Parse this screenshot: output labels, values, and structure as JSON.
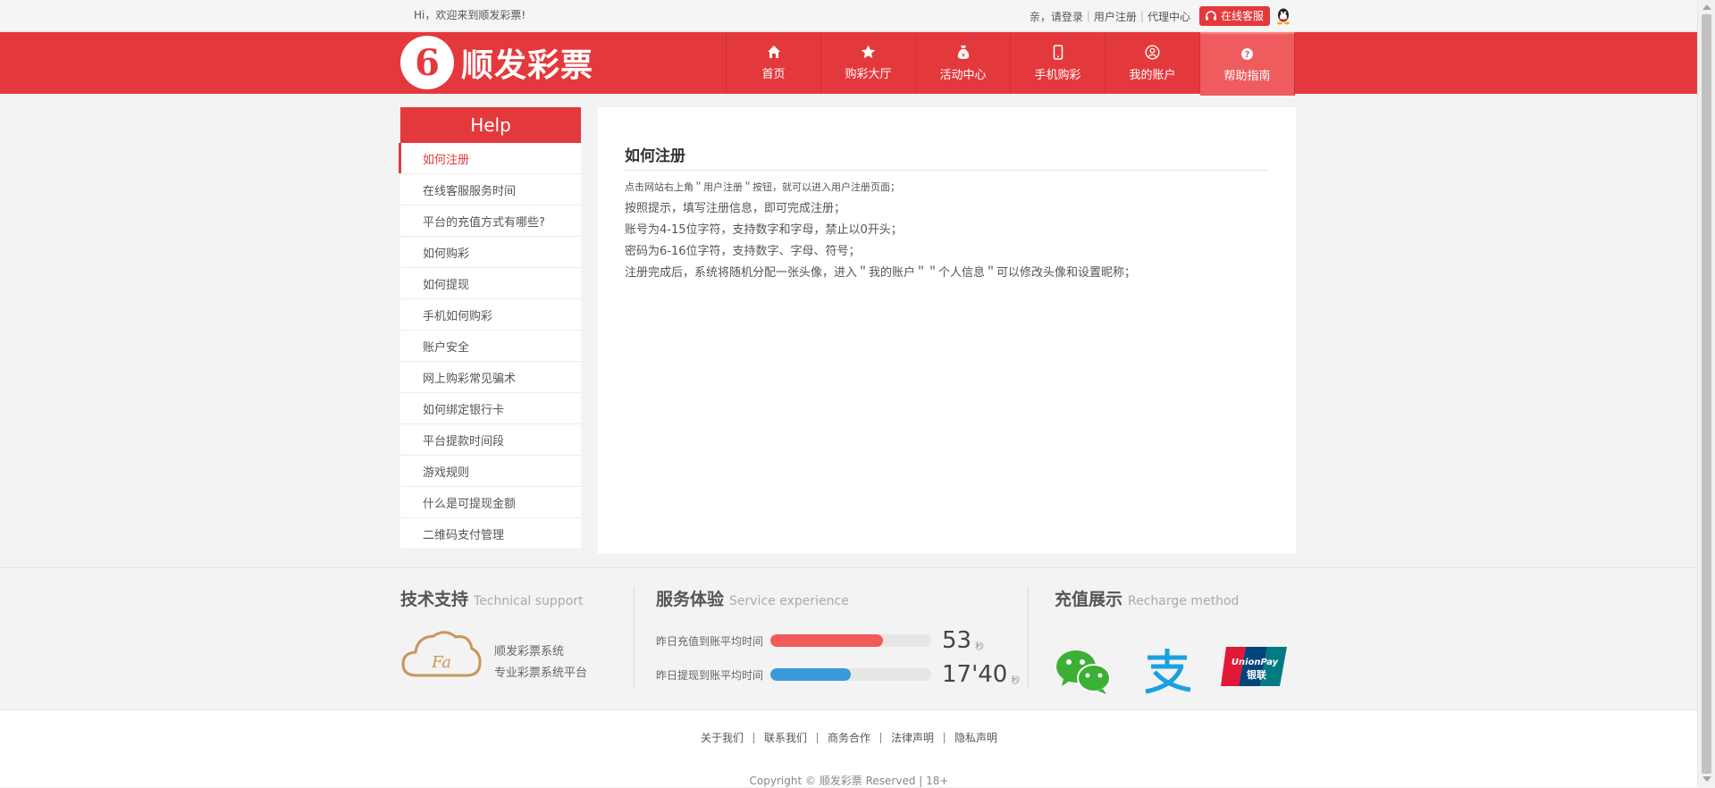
{
  "topbar": {
    "greeting": "Hi，欢迎来到顺发彩票!",
    "login_prefix": "亲，请登录",
    "register": "用户注册",
    "agent": "代理中心",
    "service_button": "在线客服"
  },
  "header": {
    "logo_mark": "6",
    "logo_name": "顺发彩票",
    "nav": [
      {
        "label": "首页",
        "icon": "home-icon"
      },
      {
        "label": "购彩大厅",
        "icon": "star-icon"
      },
      {
        "label": "活动中心",
        "icon": "money-bag-icon"
      },
      {
        "label": "手机购彩",
        "icon": "phone-icon"
      },
      {
        "label": "我的账户",
        "icon": "user-icon"
      },
      {
        "label": "帮助指南",
        "icon": "question-icon"
      }
    ]
  },
  "sidebar": {
    "title": "Help",
    "items": [
      "如何注册",
      "在线客服服务时间",
      "平台的充值方式有哪些?",
      "如何购彩",
      "如何提现",
      "手机如何购彩",
      "账户安全",
      "网上购彩常见骗术",
      "如何绑定银行卡",
      "平台提款时间段",
      "游戏规则",
      "什么是可提现金额",
      "二维码支付管理"
    ]
  },
  "content": {
    "title": "如何注册",
    "paragraphs": [
      "点击网站右上角＂用户注册＂按钮，就可以进入用户注册页面；",
      "按照提示，填写注册信息，即可完成注册；",
      "账号为4-15位字符，支持数字和字母，禁止以0开头；",
      "密码为6-16位字符，支持数字、字母、符号；",
      "注册完成后，系统将随机分配一张头像，进入＂我的账户＂＂个人信息＂可以修改头像和设置昵称；"
    ]
  },
  "service": {
    "support": {
      "title": "技术支持",
      "subtitle": "Technical support",
      "cloud_text": "Fa",
      "line1": "顺发彩票系统",
      "line2": "专业彩票系统平台"
    },
    "experience": {
      "title": "服务体验",
      "subtitle": "Service experience",
      "metrics": [
        {
          "label": "昨日充值到账平均时间",
          "value": "53",
          "unit": "秒",
          "fill": 0.7,
          "color": "#f25a5a"
        },
        {
          "label": "昨日提现到账平均时间",
          "value": "17'40",
          "unit": "秒",
          "fill": 0.5,
          "color": "#3a9ad9"
        }
      ]
    },
    "recharge": {
      "title": "充值展示",
      "subtitle": "Recharge method",
      "methods": [
        "wechat-icon",
        "alipay-icon",
        "unionpay-icon"
      ],
      "unionpay_text": "UnionPay",
      "unionpay_cn": "银联"
    }
  },
  "footer": {
    "links": [
      "关于我们",
      "联系我们",
      "商务合作",
      "法律声明",
      "隐私声明"
    ],
    "copyright": "Copyright © 顺发彩票 Reserved | 18+"
  },
  "colors": {
    "brand_red": "#e4393c",
    "active_nav": "#ee5c5e"
  }
}
